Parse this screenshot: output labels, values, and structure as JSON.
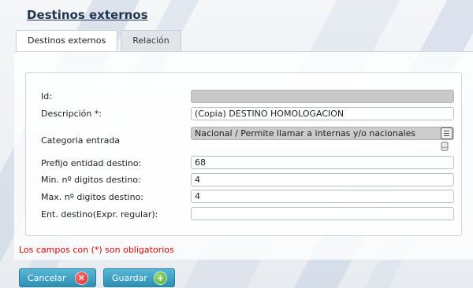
{
  "page": {
    "title": "Destinos externos"
  },
  "tabs": [
    {
      "label": "Destinos externos",
      "active": true
    },
    {
      "label": "Relación",
      "active": false
    }
  ],
  "form": {
    "id": {
      "label": "Id:",
      "value": ""
    },
    "descripcion": {
      "label": "Descripción *:",
      "value": "(Copia) DESTINO HOMOLOGACION"
    },
    "categoria": {
      "label": "Categoria entrada",
      "value": "Nacional / Permite llamar a internas y/o nacionales"
    },
    "prefijo": {
      "label": "Prefijo entidad destino:",
      "value": "68"
    },
    "min_digitos": {
      "label": "Min. nº digitos destino:",
      "value": "4"
    },
    "max_digitos": {
      "label": "Max. nº digitos destino:",
      "value": "4"
    },
    "ent_destino": {
      "label": "Ent. destino(Expr. regular):",
      "value": ""
    }
  },
  "required_note": "Los campos con (*) son obligatorios",
  "buttons": {
    "cancel": {
      "label": "Cancelar",
      "icon": "cancel-x-icon"
    },
    "save": {
      "label": "Guardar",
      "icon": "plus-icon"
    }
  },
  "colors": {
    "title": "#1e3550",
    "required_text": "#e00000",
    "button": "#3a9cc0",
    "cancel_icon": "#d32020",
    "save_icon": "#4aa52a"
  }
}
